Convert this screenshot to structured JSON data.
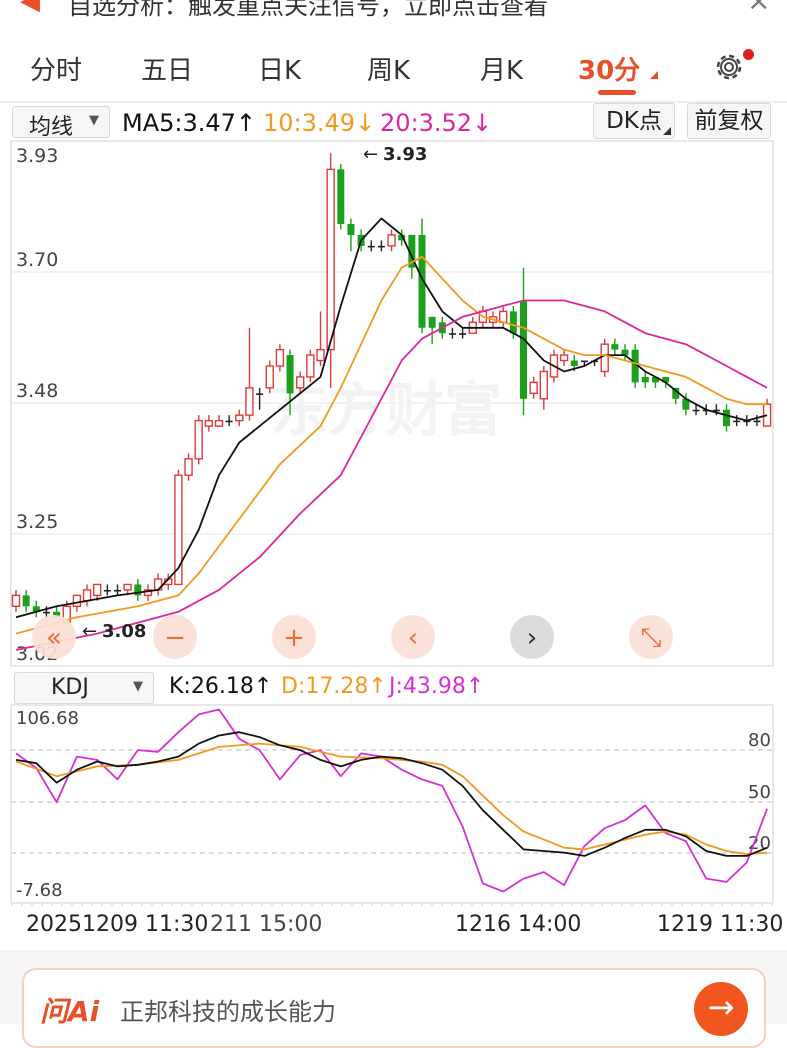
{
  "notice": {
    "text": "自选分析：触发重点关注信号，立即点击查看",
    "close_icon": "close-icon",
    "speaker_icon": "speaker-icon"
  },
  "tabs": [
    {
      "label": "分时",
      "active": false
    },
    {
      "label": "五日",
      "active": false
    },
    {
      "label": "日K",
      "active": false
    },
    {
      "label": "周K",
      "active": false
    },
    {
      "label": "月K",
      "active": false
    },
    {
      "label": "30分",
      "active": true
    }
  ],
  "settings_icon": "gear-icon",
  "ma_bar": {
    "indicator_select": "均线",
    "ma5": "MA5:3.47↑",
    "ma10": "10:3.49↓",
    "ma20": "20:3.52↓",
    "dk_button": "DK点",
    "adjust_button": "前复权"
  },
  "price_axis": [
    "3.93",
    "3.70",
    "3.48",
    "3.25",
    "3.02"
  ],
  "annotations": {
    "high": "3.93",
    "low": "3.08"
  },
  "watermark": "东方财富",
  "chart_tools": [
    {
      "icon": "fast-back-icon",
      "glyph": "«"
    },
    {
      "icon": "zoom-out-icon",
      "glyph": "−"
    },
    {
      "icon": "zoom-in-icon",
      "glyph": "+"
    },
    {
      "icon": "scroll-left-icon",
      "glyph": "‹"
    },
    {
      "icon": "scroll-right-icon",
      "glyph": "›"
    },
    {
      "icon": "fullscreen-icon",
      "glyph": "⤡"
    }
  ],
  "kdj_bar": {
    "indicator_select": "KDJ",
    "k": "K:26.18↑",
    "d": "D:17.28↑",
    "j": "J:43.98↑"
  },
  "kdj_axis": {
    "max": "106.68",
    "min": "-7.68",
    "levels": [
      "80",
      "50",
      "20"
    ]
  },
  "x_axis": [
    "20251209 11:30",
    "211 15:00",
    "1216 14:00",
    "1219 11:30"
  ],
  "ask": {
    "logo": "问Ai",
    "text": "正邦科技的成长能力",
    "send_icon": "arrow-right-icon"
  },
  "colors": {
    "up": "#e03a3a",
    "down": "#1aa01a",
    "ma5": "#111111",
    "ma10": "#f39a1e",
    "ma20": "#e0269c",
    "accent": "#e8502a",
    "j": "#d630d6"
  },
  "chart_data": {
    "type": "candlestick",
    "ylim": [
      3.02,
      3.93
    ],
    "candles": [
      [
        3.1,
        3.12,
        3.13,
        3.09
      ],
      [
        3.12,
        3.1,
        3.13,
        3.09
      ],
      [
        3.1,
        3.09,
        3.11,
        3.08
      ],
      [
        3.09,
        3.09,
        3.1,
        3.08
      ],
      [
        3.09,
        3.08,
        3.1,
        3.08
      ],
      [
        3.07,
        3.1,
        3.11,
        3.07
      ],
      [
        3.1,
        3.12,
        3.12,
        3.09
      ],
      [
        3.11,
        3.13,
        3.14,
        3.1
      ],
      [
        3.12,
        3.14,
        3.14,
        3.11
      ],
      [
        3.13,
        3.13,
        3.14,
        3.12
      ],
      [
        3.13,
        3.13,
        3.14,
        3.12
      ],
      [
        3.13,
        3.14,
        3.14,
        3.12
      ],
      [
        3.14,
        3.12,
        3.15,
        3.11
      ],
      [
        3.12,
        3.13,
        3.14,
        3.11
      ],
      [
        3.13,
        3.15,
        3.16,
        3.12
      ],
      [
        3.14,
        3.15,
        3.16,
        3.13
      ],
      [
        3.14,
        3.34,
        3.35,
        3.14
      ],
      [
        3.34,
        3.37,
        3.38,
        3.33
      ],
      [
        3.37,
        3.44,
        3.45,
        3.36
      ],
      [
        3.43,
        3.44,
        3.45,
        3.42
      ],
      [
        3.43,
        3.44,
        3.45,
        3.43
      ],
      [
        3.44,
        3.44,
        3.45,
        3.43
      ],
      [
        3.44,
        3.45,
        3.46,
        3.43
      ],
      [
        3.45,
        3.5,
        3.61,
        3.44
      ],
      [
        3.49,
        3.49,
        3.5,
        3.46
      ],
      [
        3.5,
        3.54,
        3.55,
        3.49
      ],
      [
        3.54,
        3.57,
        3.58,
        3.53
      ],
      [
        3.56,
        3.49,
        3.57,
        3.45
      ],
      [
        3.5,
        3.52,
        3.53,
        3.49
      ],
      [
        3.52,
        3.56,
        3.57,
        3.51
      ],
      [
        3.55,
        3.57,
        3.64,
        3.54
      ],
      [
        3.57,
        3.9,
        3.93,
        3.5
      ],
      [
        3.9,
        3.8,
        3.91,
        3.79
      ],
      [
        3.8,
        3.78,
        3.81,
        3.75
      ],
      [
        3.78,
        3.76,
        3.79,
        3.75
      ],
      [
        3.76,
        3.76,
        3.77,
        3.75
      ],
      [
        3.76,
        3.76,
        3.77,
        3.75
      ],
      [
        3.76,
        3.78,
        3.79,
        3.75
      ],
      [
        3.78,
        3.77,
        3.79,
        3.76
      ],
      [
        3.78,
        3.72,
        3.78,
        3.7
      ],
      [
        3.78,
        3.61,
        3.81,
        3.6
      ],
      [
        3.63,
        3.61,
        3.63,
        3.58
      ],
      [
        3.62,
        3.6,
        3.63,
        3.59
      ],
      [
        3.6,
        3.6,
        3.61,
        3.59
      ],
      [
        3.6,
        3.6,
        3.61,
        3.59
      ],
      [
        3.6,
        3.62,
        3.63,
        3.6
      ],
      [
        3.62,
        3.64,
        3.65,
        3.61
      ],
      [
        3.62,
        3.63,
        3.64,
        3.61
      ],
      [
        3.62,
        3.64,
        3.65,
        3.61
      ],
      [
        3.64,
        3.6,
        3.65,
        3.59
      ],
      [
        3.66,
        3.48,
        3.72,
        3.45
      ],
      [
        3.49,
        3.51,
        3.52,
        3.48
      ],
      [
        3.48,
        3.53,
        3.54,
        3.46
      ],
      [
        3.52,
        3.56,
        3.57,
        3.51
      ],
      [
        3.55,
        3.56,
        3.57,
        3.54
      ],
      [
        3.55,
        3.54,
        3.56,
        3.53
      ],
      [
        3.55,
        3.55,
        3.55,
        3.54
      ],
      [
        3.55,
        3.55,
        3.55,
        3.54
      ],
      [
        3.53,
        3.58,
        3.59,
        3.52
      ],
      [
        3.58,
        3.57,
        3.59,
        3.56
      ],
      [
        3.57,
        3.56,
        3.58,
        3.55
      ],
      [
        3.57,
        3.51,
        3.58,
        3.5
      ],
      [
        3.52,
        3.51,
        3.53,
        3.5
      ],
      [
        3.52,
        3.51,
        3.52,
        3.5
      ],
      [
        3.52,
        3.51,
        3.52,
        3.5
      ],
      [
        3.5,
        3.48,
        3.5,
        3.47
      ],
      [
        3.48,
        3.46,
        3.49,
        3.45
      ],
      [
        3.46,
        3.46,
        3.47,
        3.45
      ],
      [
        3.46,
        3.46,
        3.47,
        3.45
      ],
      [
        3.46,
        3.46,
        3.47,
        3.45
      ],
      [
        3.46,
        3.43,
        3.47,
        3.42
      ],
      [
        3.44,
        3.44,
        3.45,
        3.43
      ],
      [
        3.44,
        3.44,
        3.45,
        3.43
      ],
      [
        3.44,
        3.44,
        3.45,
        3.43
      ],
      [
        3.43,
        3.47,
        3.48,
        3.43
      ]
    ],
    "ma5": [
      [
        0,
        3.08
      ],
      [
        4,
        3.1
      ],
      [
        10,
        3.12
      ],
      [
        14,
        3.13
      ],
      [
        16,
        3.17
      ],
      [
        18,
        3.24
      ],
      [
        20,
        3.34
      ],
      [
        22,
        3.4
      ],
      [
        26,
        3.46
      ],
      [
        30,
        3.52
      ],
      [
        32,
        3.65
      ],
      [
        34,
        3.77
      ],
      [
        36,
        3.81
      ],
      [
        38,
        3.78
      ],
      [
        40,
        3.7
      ],
      [
        42,
        3.64
      ],
      [
        44,
        3.61
      ],
      [
        46,
        3.61
      ],
      [
        48,
        3.61
      ],
      [
        50,
        3.59
      ],
      [
        52,
        3.55
      ],
      [
        54,
        3.53
      ],
      [
        56,
        3.54
      ],
      [
        58,
        3.56
      ],
      [
        60,
        3.56
      ],
      [
        62,
        3.53
      ],
      [
        64,
        3.51
      ],
      [
        66,
        3.48
      ],
      [
        68,
        3.46
      ],
      [
        70,
        3.45
      ],
      [
        72,
        3.44
      ],
      [
        74,
        3.45
      ]
    ],
    "ma10": [
      [
        0,
        3.05
      ],
      [
        6,
        3.08
      ],
      [
        12,
        3.1
      ],
      [
        16,
        3.12
      ],
      [
        18,
        3.16
      ],
      [
        22,
        3.26
      ],
      [
        26,
        3.36
      ],
      [
        30,
        3.43
      ],
      [
        32,
        3.5
      ],
      [
        34,
        3.58
      ],
      [
        36,
        3.66
      ],
      [
        38,
        3.72
      ],
      [
        40,
        3.74
      ],
      [
        42,
        3.7
      ],
      [
        44,
        3.66
      ],
      [
        46,
        3.63
      ],
      [
        48,
        3.62
      ],
      [
        50,
        3.61
      ],
      [
        52,
        3.59
      ],
      [
        54,
        3.57
      ],
      [
        56,
        3.56
      ],
      [
        58,
        3.56
      ],
      [
        60,
        3.55
      ],
      [
        62,
        3.54
      ],
      [
        64,
        3.53
      ],
      [
        66,
        3.52
      ],
      [
        68,
        3.5
      ],
      [
        70,
        3.48
      ],
      [
        72,
        3.47
      ],
      [
        74,
        3.47
      ]
    ],
    "ma20": [
      [
        0,
        3.02
      ],
      [
        8,
        3.05
      ],
      [
        14,
        3.08
      ],
      [
        16,
        3.09
      ],
      [
        20,
        3.13
      ],
      [
        24,
        3.19
      ],
      [
        28,
        3.27
      ],
      [
        32,
        3.34
      ],
      [
        34,
        3.41
      ],
      [
        36,
        3.48
      ],
      [
        38,
        3.55
      ],
      [
        40,
        3.59
      ],
      [
        42,
        3.61
      ],
      [
        44,
        3.63
      ],
      [
        46,
        3.64
      ],
      [
        48,
        3.65
      ],
      [
        50,
        3.66
      ],
      [
        52,
        3.66
      ],
      [
        54,
        3.66
      ],
      [
        56,
        3.65
      ],
      [
        58,
        3.64
      ],
      [
        60,
        3.62
      ],
      [
        62,
        3.6
      ],
      [
        64,
        3.59
      ],
      [
        66,
        3.58
      ],
      [
        68,
        3.56
      ],
      [
        70,
        3.54
      ],
      [
        72,
        3.52
      ],
      [
        74,
        3.5
      ]
    ],
    "kdj": {
      "ylim": [
        -7.68,
        106.68
      ],
      "K": [
        [
          0,
          76
        ],
        [
          2,
          74
        ],
        [
          4,
          62
        ],
        [
          6,
          70
        ],
        [
          8,
          75
        ],
        [
          10,
          72
        ],
        [
          12,
          73
        ],
        [
          14,
          75
        ],
        [
          16,
          78
        ],
        [
          18,
          86
        ],
        [
          20,
          91
        ],
        [
          22,
          93
        ],
        [
          24,
          90
        ],
        [
          26,
          85
        ],
        [
          28,
          82
        ],
        [
          30,
          76
        ],
        [
          32,
          72
        ],
        [
          34,
          76
        ],
        [
          36,
          78
        ],
        [
          38,
          77
        ],
        [
          40,
          74
        ],
        [
          42,
          70
        ],
        [
          44,
          60
        ],
        [
          46,
          45
        ],
        [
          48,
          33
        ],
        [
          50,
          21
        ],
        [
          52,
          20
        ],
        [
          54,
          19
        ],
        [
          56,
          17
        ],
        [
          58,
          22
        ],
        [
          60,
          28
        ],
        [
          62,
          33
        ],
        [
          64,
          33
        ],
        [
          66,
          29
        ],
        [
          68,
          20
        ],
        [
          70,
          17
        ],
        [
          72,
          17
        ],
        [
          74,
          22
        ]
      ],
      "D": [
        [
          0,
          75
        ],
        [
          4,
          66
        ],
        [
          8,
          72
        ],
        [
          12,
          73
        ],
        [
          16,
          76
        ],
        [
          20,
          84
        ],
        [
          24,
          86
        ],
        [
          28,
          84
        ],
        [
          32,
          78
        ],
        [
          36,
          77
        ],
        [
          40,
          75
        ],
        [
          42,
          73
        ],
        [
          44,
          66
        ],
        [
          46,
          54
        ],
        [
          48,
          42
        ],
        [
          50,
          32
        ],
        [
          52,
          27
        ],
        [
          54,
          22
        ],
        [
          56,
          21
        ],
        [
          58,
          24
        ],
        [
          60,
          27
        ],
        [
          62,
          30
        ],
        [
          64,
          32
        ],
        [
          66,
          30
        ],
        [
          68,
          24
        ],
        [
          70,
          20
        ],
        [
          72,
          18
        ],
        [
          74,
          19
        ]
      ],
      "J": [
        [
          0,
          80
        ],
        [
          2,
          71
        ],
        [
          4,
          50
        ],
        [
          6,
          78
        ],
        [
          8,
          76
        ],
        [
          10,
          64
        ],
        [
          12,
          82
        ],
        [
          14,
          81
        ],
        [
          16,
          93
        ],
        [
          18,
          104
        ],
        [
          20,
          107
        ],
        [
          22,
          89
        ],
        [
          24,
          82
        ],
        [
          26,
          64
        ],
        [
          28,
          79
        ],
        [
          30,
          82
        ],
        [
          32,
          66
        ],
        [
          34,
          80
        ],
        [
          36,
          78
        ],
        [
          38,
          70
        ],
        [
          40,
          64
        ],
        [
          42,
          60
        ],
        [
          44,
          35
        ],
        [
          46,
          0
        ],
        [
          48,
          -5
        ],
        [
          50,
          3
        ],
        [
          52,
          7
        ],
        [
          54,
          -1
        ],
        [
          56,
          23
        ],
        [
          58,
          34
        ],
        [
          60,
          39
        ],
        [
          62,
          48
        ],
        [
          64,
          31
        ],
        [
          66,
          26
        ],
        [
          68,
          3
        ],
        [
          70,
          1
        ],
        [
          72,
          13
        ],
        [
          74,
          46
        ]
      ]
    }
  }
}
